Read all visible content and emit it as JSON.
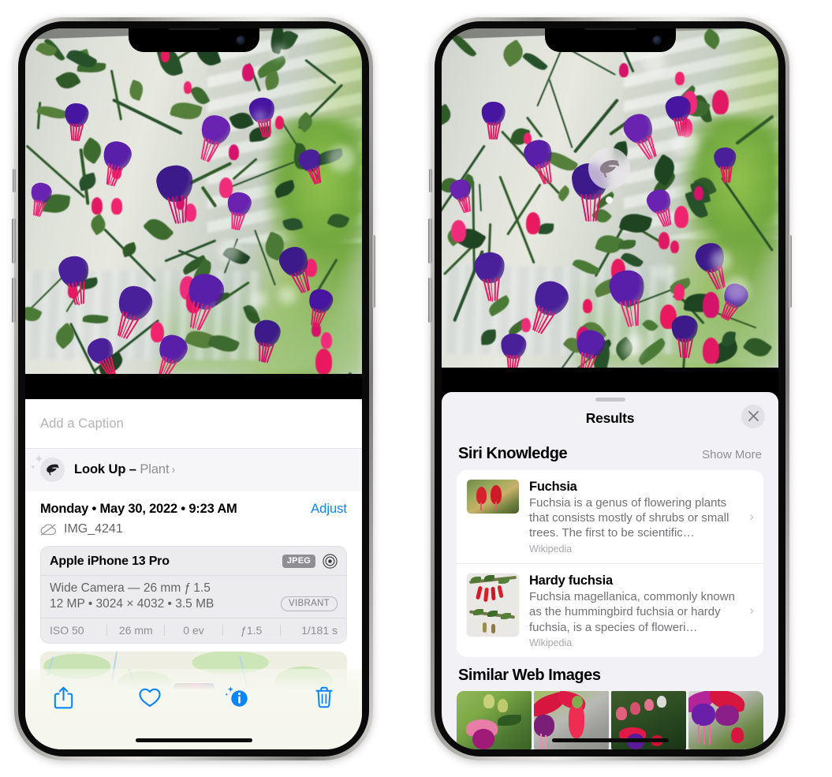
{
  "left_phone": {
    "name": "photos-detail-screen",
    "caption": {
      "placeholder": "Add a Caption",
      "value": ""
    },
    "look_up": {
      "label": "Look Up – ",
      "subject": "Plant",
      "chevron": "›",
      "icon": "leaf-icon"
    },
    "info": {
      "datetime": "Monday • May 30, 2022 • 9:23 AM",
      "adjust_label": "Adjust",
      "filename": "IMG_4241",
      "cloud_icon": "icloud-slash-icon"
    },
    "camera_card": {
      "device": "Apple iPhone 13 Pro",
      "format_badge": "JPEG",
      "aperture_icon": "aperture-icon",
      "lens_line": "Wide Camera — 26 mm ƒ 1.5",
      "specs_line": "12 MP • 3024 × 4032 • 3.5 MB",
      "style_badge": "VIBRANT",
      "exif": [
        "ISO 50",
        "26 mm",
        "0 ev",
        "ƒ1.5",
        "1/181 s"
      ]
    },
    "toolbar": [
      {
        "name": "share-button",
        "icon": "share-icon"
      },
      {
        "name": "favorite-button",
        "icon": "heart-icon"
      },
      {
        "name": "info-button",
        "icon": "info-sparkle-icon"
      },
      {
        "name": "delete-button",
        "icon": "trash-icon"
      }
    ],
    "accent_color": "#0a84ff"
  },
  "right_phone": {
    "name": "visual-look-up-results-screen",
    "badge": {
      "name": "visual-look-up-badge",
      "icon": "leaf-icon"
    },
    "sheet": {
      "title": "Results",
      "close_icon": "close-icon",
      "siri_knowledge": {
        "heading": "Siri Knowledge",
        "action": "Show More",
        "items": [
          {
            "title": "Fuchsia",
            "description": "Fuchsia is a genus of flowering plants that consists mostly of shrubs or small trees. The first to be scientific…",
            "source": "Wikipedia"
          },
          {
            "title": "Hardy fuchsia",
            "description": "Fuchsia magellanica, commonly known as the hummingbird fuchsia or hardy fuchsia, is a species of floweri…",
            "source": "Wikipedia"
          }
        ]
      },
      "similar_web_images": {
        "heading": "Similar Web Images",
        "count": 4
      }
    },
    "panel_color": "#f2f1f6"
  }
}
